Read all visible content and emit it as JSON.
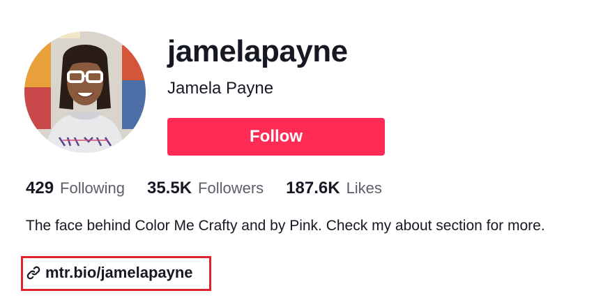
{
  "profile": {
    "username": "jamelapayne",
    "display_name": "Jamela Payne",
    "follow_label": "Follow",
    "avatar_icon": "profile-photo",
    "stats": [
      {
        "count": "429",
        "label": "Following"
      },
      {
        "count": "35.5K",
        "label": "Followers"
      },
      {
        "count": "187.6K",
        "label": "Likes"
      }
    ],
    "bio": "The face behind Color Me Crafty and by Pink. Check my about section for more.",
    "link": {
      "icon": "link-icon",
      "text": "mtr.bio/jamelapayne"
    }
  },
  "colors": {
    "follow_button": "#fe2c55",
    "highlight_border": "#e0232e",
    "primary_text": "#161823",
    "secondary_text": "#5c5f69"
  }
}
